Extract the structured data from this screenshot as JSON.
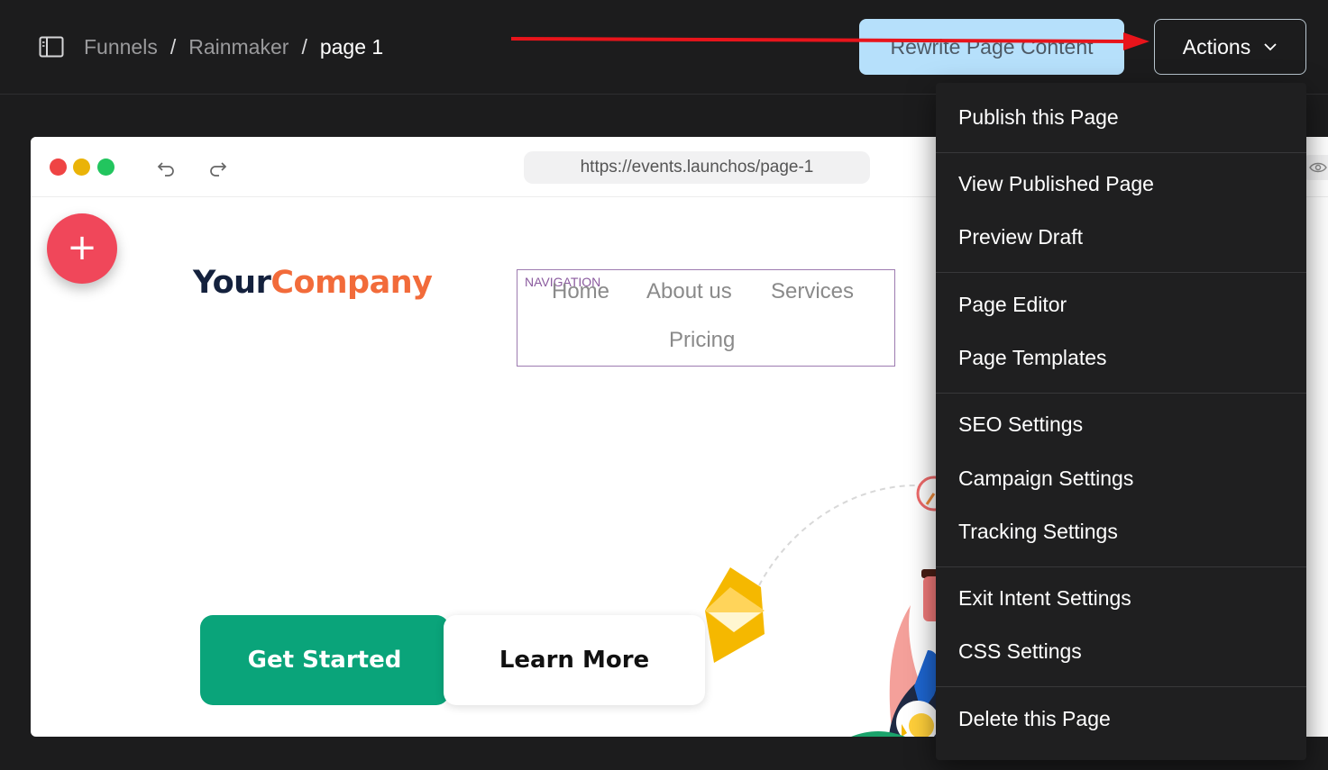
{
  "breadcrumb": {
    "items": [
      "Funnels",
      "Rainmaker"
    ],
    "current": "page 1",
    "separator": "/"
  },
  "header": {
    "rewrite_label": "Rewrite Page Content",
    "actions_label": "Actions"
  },
  "browser": {
    "url": "https://events.launchos/page-1"
  },
  "page": {
    "fab_label": "+",
    "logo_part1": "Your",
    "logo_part2": "Company",
    "nav_label": "NAVIGATION",
    "nav_links": [
      "Home",
      "About us",
      "Services",
      "Pricing"
    ],
    "cta_primary": "Get Started",
    "cta_secondary": "Learn More"
  },
  "actions_menu": {
    "items": [
      "Publish this Page",
      "View Published Page",
      "Preview Draft",
      "Page Editor",
      "Page Templates",
      "SEO Settings",
      "Campaign Settings",
      "Tracking Settings",
      "Exit Intent Settings",
      "CSS Settings",
      "Delete this Page"
    ]
  },
  "colors": {
    "annotation_arrow": "#e8141b",
    "rewrite_button_bg": "#b6e0fb",
    "primary_cta": "#0aa47a",
    "fab": "#f0475a",
    "logo_dark": "#14213d",
    "logo_accent": "#f26b3a"
  },
  "icons": {
    "sidebar_toggle": "sidebar-panel-icon",
    "actions_chevron": "chevron-down-icon",
    "undo": "undo-icon",
    "redo": "redo-icon",
    "preview": "eye-icon"
  }
}
